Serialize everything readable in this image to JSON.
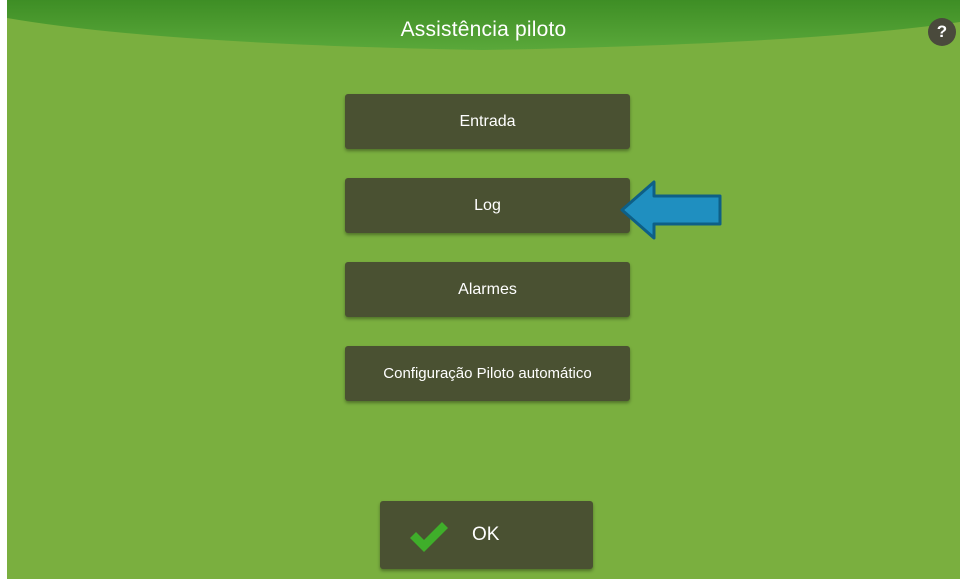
{
  "header": {
    "title": "Assistência piloto",
    "help_label": "?"
  },
  "menu": {
    "items": [
      {
        "label": "Entrada"
      },
      {
        "label": "Log"
      },
      {
        "label": "Alarmes"
      },
      {
        "label": "Configuração Piloto automático"
      }
    ],
    "highlight_arrow": {
      "target": "Log",
      "color": "#1f8fc0"
    }
  },
  "footer": {
    "ok_label": "OK",
    "ok_icon": "checkmark-icon"
  },
  "colors": {
    "background": "#7aaf3f",
    "header": "#4f9e2f",
    "button": "#4a5132",
    "check": "#3fae2a"
  }
}
